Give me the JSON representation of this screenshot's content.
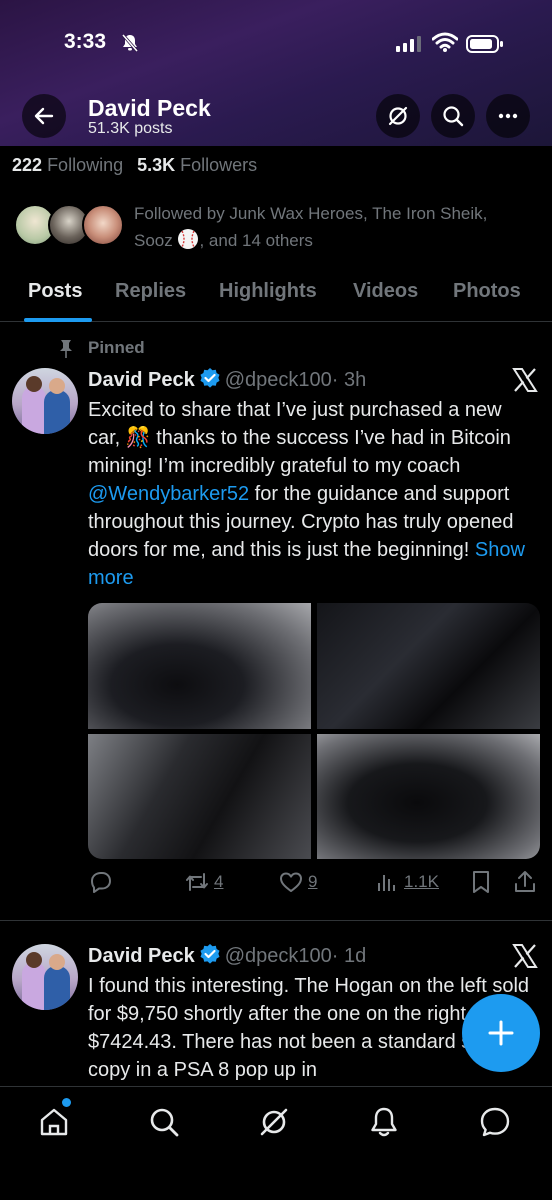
{
  "status_bar": {
    "time": "3:33"
  },
  "header": {
    "name": "David Peck",
    "posts": "51.3K posts"
  },
  "stats": {
    "following_count": "222",
    "following_label": "Following",
    "followers_count": "5.3K",
    "followers_label": "Followers"
  },
  "followed_by": {
    "line1": "Followed by Junk Wax Heroes, The Iron Sheik,",
    "line2_a": "Sooz",
    "line2_b": ", and 14 others"
  },
  "tabs": [
    {
      "label": "Posts",
      "active": true
    },
    {
      "label": "Replies"
    },
    {
      "label": "Highlights"
    },
    {
      "label": "Videos"
    },
    {
      "label": "Photos"
    }
  ],
  "post1": {
    "pinned_label": "Pinned",
    "name": "David Peck",
    "handle": "@dpeck100",
    "time": "· 3h",
    "text_a": "Excited to share that I’ve just purchased a new car, 🎊 thanks to the success I’ve had in Bitcoin mining! I’m incredibly grateful to my coach ",
    "mention": "@Wendybarker52",
    "text_b": " for the guidance and support throughout this journey. Crypto has truly opened doors for me, and this is just the beginning! ",
    "show_more": "Show more",
    "retweets": "4",
    "likes": "9",
    "views": "1.1K"
  },
  "post2": {
    "name": "David Peck",
    "handle": "@dpeck100",
    "time": "· 1d",
    "text": "I found this interesting. The Hogan on the left sold for $9,750 shortly after the one on the right for $7424.43. There has not been a standard sized copy in a PSA 8 pop up in"
  },
  "colors": {
    "accent": "#1d9bf0",
    "muted": "#71767b",
    "text": "#e7e9ea",
    "background": "#000000"
  }
}
